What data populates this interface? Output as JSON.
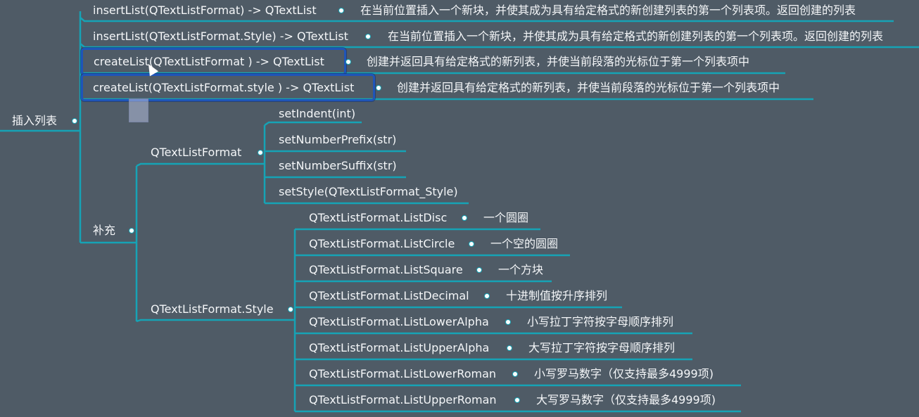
{
  "colors": {
    "background": "#4f5b66",
    "connector": "#16a3b5",
    "selection": "#1f55b8",
    "text": "#f4f6f8"
  },
  "root": {
    "label": "插入列表"
  },
  "methods": [
    {
      "signature": "insertList(QTextListFormat) -> QTextList",
      "desc": "在当前位置插入一个新块，并使其成为具有给定格式的新创建列表的第一个列表项。返回创建的列表"
    },
    {
      "signature": "insertList(QTextListFormat.Style) -> QTextList",
      "desc": "在当前位置插入一个新块，并使其成为具有给定格式的新创建列表的第一个列表项。返回创建的列表"
    },
    {
      "signature": "createList(QTextListFormat ) -> QTextList",
      "desc": "创建并返回具有给定格式的新列表，并使当前段落的光标位于第一个列表项中"
    },
    {
      "signature": "createList(QTextListFormat.style ) -> QTextList",
      "desc": "创建并返回具有给定格式的新列表，并使当前段落的光标位于第一个列表项中"
    }
  ],
  "supplement": {
    "label": "补充",
    "format": {
      "label": "QTextListFormat",
      "items": [
        "setIndent(int)",
        "setNumberPrefix(str)",
        "setNumberSuffix(str)",
        "setStyle(QTextListFormat_Style)"
      ]
    },
    "style": {
      "label": "QTextListFormat.Style",
      "items": [
        {
          "name": "QTextListFormat.ListDisc",
          "desc": "一个圆圈"
        },
        {
          "name": "QTextListFormat.ListCircle",
          "desc": "一个空的圆圈"
        },
        {
          "name": "QTextListFormat.ListSquare",
          "desc": "一个方块"
        },
        {
          "name": "QTextListFormat.ListDecimal",
          "desc": "十进制值按升序排列"
        },
        {
          "name": "QTextListFormat.ListLowerAlpha",
          "desc": "小写拉丁字符按字母顺序排列"
        },
        {
          "name": "QTextListFormat.ListUpperAlpha",
          "desc": "大写拉丁字符按字母顺序排列"
        },
        {
          "name": "QTextListFormat.ListLowerRoman",
          "desc": "小写罗马数字（仅支持最多4999项)"
        },
        {
          "name": "QTextListFormat.ListUpperRoman",
          "desc": "大写罗马数字（仅支持最多4999项)"
        }
      ]
    }
  }
}
